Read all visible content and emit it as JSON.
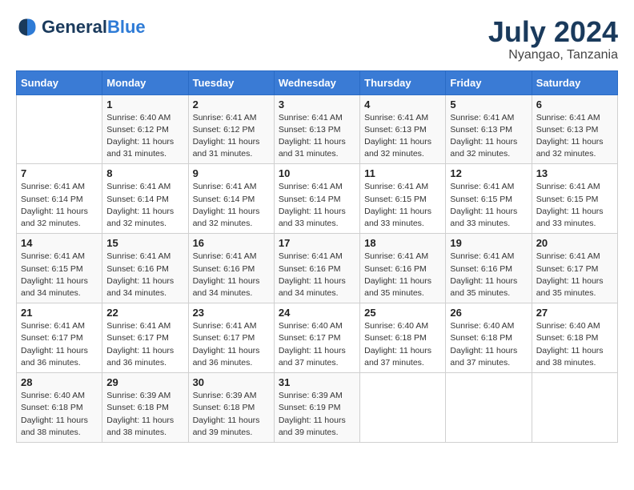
{
  "header": {
    "logo_general": "General",
    "logo_blue": "Blue",
    "month_year": "July 2024",
    "location": "Nyangao, Tanzania"
  },
  "days_of_week": [
    "Sunday",
    "Monday",
    "Tuesday",
    "Wednesday",
    "Thursday",
    "Friday",
    "Saturday"
  ],
  "weeks": [
    [
      {
        "day": "",
        "sunrise": "",
        "sunset": "",
        "daylight": ""
      },
      {
        "day": "1",
        "sunrise": "Sunrise: 6:40 AM",
        "sunset": "Sunset: 6:12 PM",
        "daylight": "Daylight: 11 hours and 31 minutes."
      },
      {
        "day": "2",
        "sunrise": "Sunrise: 6:41 AM",
        "sunset": "Sunset: 6:12 PM",
        "daylight": "Daylight: 11 hours and 31 minutes."
      },
      {
        "day": "3",
        "sunrise": "Sunrise: 6:41 AM",
        "sunset": "Sunset: 6:13 PM",
        "daylight": "Daylight: 11 hours and 31 minutes."
      },
      {
        "day": "4",
        "sunrise": "Sunrise: 6:41 AM",
        "sunset": "Sunset: 6:13 PM",
        "daylight": "Daylight: 11 hours and 32 minutes."
      },
      {
        "day": "5",
        "sunrise": "Sunrise: 6:41 AM",
        "sunset": "Sunset: 6:13 PM",
        "daylight": "Daylight: 11 hours and 32 minutes."
      },
      {
        "day": "6",
        "sunrise": "Sunrise: 6:41 AM",
        "sunset": "Sunset: 6:13 PM",
        "daylight": "Daylight: 11 hours and 32 minutes."
      }
    ],
    [
      {
        "day": "7",
        "sunrise": "Sunrise: 6:41 AM",
        "sunset": "Sunset: 6:14 PM",
        "daylight": "Daylight: 11 hours and 32 minutes."
      },
      {
        "day": "8",
        "sunrise": "Sunrise: 6:41 AM",
        "sunset": "Sunset: 6:14 PM",
        "daylight": "Daylight: 11 hours and 32 minutes."
      },
      {
        "day": "9",
        "sunrise": "Sunrise: 6:41 AM",
        "sunset": "Sunset: 6:14 PM",
        "daylight": "Daylight: 11 hours and 32 minutes."
      },
      {
        "day": "10",
        "sunrise": "Sunrise: 6:41 AM",
        "sunset": "Sunset: 6:14 PM",
        "daylight": "Daylight: 11 hours and 33 minutes."
      },
      {
        "day": "11",
        "sunrise": "Sunrise: 6:41 AM",
        "sunset": "Sunset: 6:15 PM",
        "daylight": "Daylight: 11 hours and 33 minutes."
      },
      {
        "day": "12",
        "sunrise": "Sunrise: 6:41 AM",
        "sunset": "Sunset: 6:15 PM",
        "daylight": "Daylight: 11 hours and 33 minutes."
      },
      {
        "day": "13",
        "sunrise": "Sunrise: 6:41 AM",
        "sunset": "Sunset: 6:15 PM",
        "daylight": "Daylight: 11 hours and 33 minutes."
      }
    ],
    [
      {
        "day": "14",
        "sunrise": "Sunrise: 6:41 AM",
        "sunset": "Sunset: 6:15 PM",
        "daylight": "Daylight: 11 hours and 34 minutes."
      },
      {
        "day": "15",
        "sunrise": "Sunrise: 6:41 AM",
        "sunset": "Sunset: 6:16 PM",
        "daylight": "Daylight: 11 hours and 34 minutes."
      },
      {
        "day": "16",
        "sunrise": "Sunrise: 6:41 AM",
        "sunset": "Sunset: 6:16 PM",
        "daylight": "Daylight: 11 hours and 34 minutes."
      },
      {
        "day": "17",
        "sunrise": "Sunrise: 6:41 AM",
        "sunset": "Sunset: 6:16 PM",
        "daylight": "Daylight: 11 hours and 34 minutes."
      },
      {
        "day": "18",
        "sunrise": "Sunrise: 6:41 AM",
        "sunset": "Sunset: 6:16 PM",
        "daylight": "Daylight: 11 hours and 35 minutes."
      },
      {
        "day": "19",
        "sunrise": "Sunrise: 6:41 AM",
        "sunset": "Sunset: 6:16 PM",
        "daylight": "Daylight: 11 hours and 35 minutes."
      },
      {
        "day": "20",
        "sunrise": "Sunrise: 6:41 AM",
        "sunset": "Sunset: 6:17 PM",
        "daylight": "Daylight: 11 hours and 35 minutes."
      }
    ],
    [
      {
        "day": "21",
        "sunrise": "Sunrise: 6:41 AM",
        "sunset": "Sunset: 6:17 PM",
        "daylight": "Daylight: 11 hours and 36 minutes."
      },
      {
        "day": "22",
        "sunrise": "Sunrise: 6:41 AM",
        "sunset": "Sunset: 6:17 PM",
        "daylight": "Daylight: 11 hours and 36 minutes."
      },
      {
        "day": "23",
        "sunrise": "Sunrise: 6:41 AM",
        "sunset": "Sunset: 6:17 PM",
        "daylight": "Daylight: 11 hours and 36 minutes."
      },
      {
        "day": "24",
        "sunrise": "Sunrise: 6:40 AM",
        "sunset": "Sunset: 6:17 PM",
        "daylight": "Daylight: 11 hours and 37 minutes."
      },
      {
        "day": "25",
        "sunrise": "Sunrise: 6:40 AM",
        "sunset": "Sunset: 6:18 PM",
        "daylight": "Daylight: 11 hours and 37 minutes."
      },
      {
        "day": "26",
        "sunrise": "Sunrise: 6:40 AM",
        "sunset": "Sunset: 6:18 PM",
        "daylight": "Daylight: 11 hours and 37 minutes."
      },
      {
        "day": "27",
        "sunrise": "Sunrise: 6:40 AM",
        "sunset": "Sunset: 6:18 PM",
        "daylight": "Daylight: 11 hours and 38 minutes."
      }
    ],
    [
      {
        "day": "28",
        "sunrise": "Sunrise: 6:40 AM",
        "sunset": "Sunset: 6:18 PM",
        "daylight": "Daylight: 11 hours and 38 minutes."
      },
      {
        "day": "29",
        "sunrise": "Sunrise: 6:39 AM",
        "sunset": "Sunset: 6:18 PM",
        "daylight": "Daylight: 11 hours and 38 minutes."
      },
      {
        "day": "30",
        "sunrise": "Sunrise: 6:39 AM",
        "sunset": "Sunset: 6:18 PM",
        "daylight": "Daylight: 11 hours and 39 minutes."
      },
      {
        "day": "31",
        "sunrise": "Sunrise: 6:39 AM",
        "sunset": "Sunset: 6:19 PM",
        "daylight": "Daylight: 11 hours and 39 minutes."
      },
      {
        "day": "",
        "sunrise": "",
        "sunset": "",
        "daylight": ""
      },
      {
        "day": "",
        "sunrise": "",
        "sunset": "",
        "daylight": ""
      },
      {
        "day": "",
        "sunrise": "",
        "sunset": "",
        "daylight": ""
      }
    ]
  ]
}
